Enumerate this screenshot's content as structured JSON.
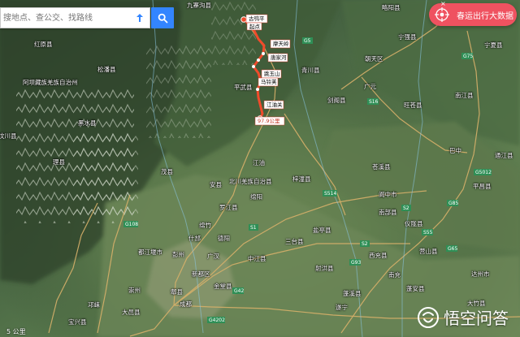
{
  "search": {
    "placeholder": "搜地点、查公交、找路线"
  },
  "badge": {
    "label": "春运出行大数据",
    "close_label": "×"
  },
  "route": {
    "labels": [
      "古鸮平",
      "起点",
      "摩天岭",
      "唐家河",
      "跳玉山",
      "马铃芙",
      "江油关",
      "97.9公里"
    ],
    "color": "#f04b2b"
  },
  "map_labels": [
    "红原县",
    "阿坝藏族羌族自治州",
    "汶川县",
    "黑水县",
    "理县",
    "茂县",
    "平武县",
    "北川羌族自治县",
    "江油",
    "绵阳",
    "梓潼县",
    "罗江县",
    "德阳",
    "什邡",
    "彭州",
    "广汉",
    "新都区",
    "郫县",
    "成都",
    "都江堰市",
    "崇州",
    "大邑县",
    "盐亭县",
    "三台县",
    "中江县",
    "射洪县",
    "蓬溪县",
    "遂宁",
    "南充",
    "西充县",
    "南部县",
    "阆中市",
    "仪陇县",
    "营山县",
    "蓬安县",
    "大竹县",
    "达州市",
    "巴中",
    "平昌县",
    "南江县",
    "通江县",
    "广元",
    "剑阁县",
    "苍溪县",
    "旺苍县",
    "宁强县",
    "朝天区",
    "青川县",
    "宁夏县",
    "略阳县",
    "九寨沟县",
    "松潘县",
    "宝兴县",
    "金堂县",
    "绵竹",
    "安县",
    "邛崃"
  ],
  "roads": [
    "G5",
    "G75",
    "G42",
    "S1",
    "S2",
    "S16",
    "G5012",
    "G4202",
    "G85",
    "G93",
    "G65",
    "S2",
    "G108",
    "S55",
    "S514"
  ],
  "watermark": {
    "brand": "悟空问答"
  },
  "scale": "5 公里",
  "colors": {
    "search_button": "#3385ff",
    "badge": "#ef5260",
    "route": "#f04b2b",
    "terrain_dark": "#2f4730",
    "terrain_mid": "#4e6a3f",
    "plain": "#5a7b50"
  }
}
